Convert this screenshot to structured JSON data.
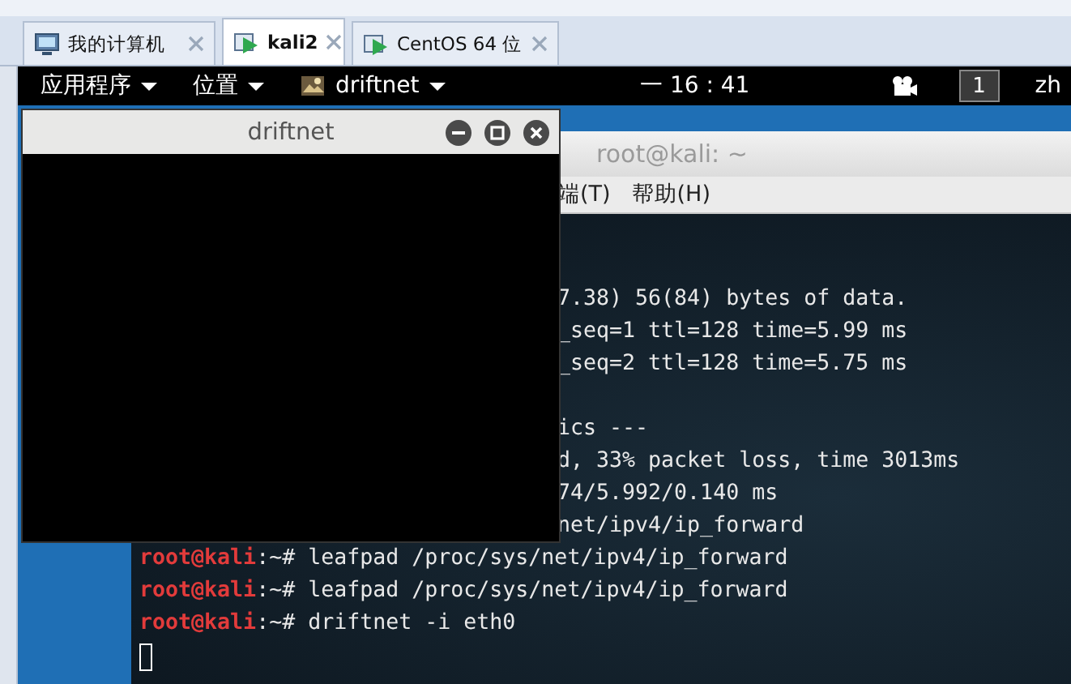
{
  "vm_tabs": [
    {
      "label": "我的计算机",
      "selected": false
    },
    {
      "label": "kali2",
      "selected": true
    },
    {
      "label": "CentOS 64 位",
      "selected": false
    }
  ],
  "panel": {
    "menus": [
      "应用程序",
      "位置"
    ],
    "app": "driftnet",
    "clock": "一 16 : 41",
    "workspace": "1",
    "input_method": "zh"
  },
  "driftnet_window": {
    "title": "driftnet"
  },
  "terminal": {
    "title": "root@kali: ~",
    "menu": [
      "端(T)",
      "帮助(H)"
    ],
    "lines": [
      {
        "kind": "clipped",
        "text": "7.38) 56(84) bytes of data."
      },
      {
        "kind": "clipped",
        "text": "_seq=1 ttl=128 time=5.99 ms"
      },
      {
        "kind": "clipped",
        "text": "_seq=2 ttl=128 time=5.75 ms"
      },
      {
        "kind": "blank"
      },
      {
        "kind": "clipped",
        "text": "ics ---"
      },
      {
        "kind": "clipped",
        "text": "d, 33% packet loss, time 3013ms"
      },
      {
        "kind": "clipped",
        "text": "74/5.992/0.140 ms"
      },
      {
        "kind": "clipped",
        "text": "net/ipv4/ip_forward"
      },
      {
        "kind": "prompt",
        "user": "root@kali",
        "text": ":~# leafpad /proc/sys/net/ipv4/ip_forward"
      },
      {
        "kind": "prompt",
        "user": "root@kali",
        "text": ":~# leafpad /proc/sys/net/ipv4/ip_forward"
      },
      {
        "kind": "prompt",
        "user": "root@kali",
        "text": ":~# driftnet -i eth0"
      },
      {
        "kind": "cursor"
      }
    ]
  }
}
